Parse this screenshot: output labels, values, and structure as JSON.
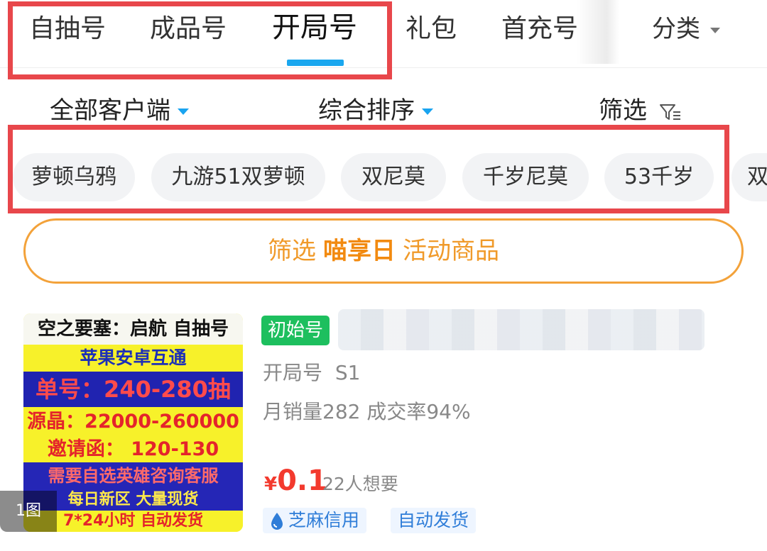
{
  "tabs": {
    "items": [
      {
        "label": "自抽号"
      },
      {
        "label": "成品号"
      },
      {
        "label": "开局号",
        "active": true
      },
      {
        "label": "礼包"
      },
      {
        "label": "首充号"
      }
    ],
    "classify_label": "分类",
    "active_color": "#1aa7ef"
  },
  "sort_bar": {
    "client": "全部客户端",
    "order": "综合排序",
    "filter": "筛选"
  },
  "chips": [
    "萝顿乌鸦",
    "九游51双萝顿",
    "双尼莫",
    "千岁尼莫",
    "53千岁",
    "双"
  ],
  "promo": {
    "prefix": "筛选",
    "highlight": "喵享日",
    "suffix": "活动商品",
    "color": "#f09a2a"
  },
  "product": {
    "thumbnail": {
      "lines": [
        "空之要塞：启航 自抽号",
        "苹果安卓互通",
        "单号：240-280抽",
        "源晶：22000-260000",
        "邀请函： 120-130",
        "需要自选英雄咨询客服",
        "每日新区  大量现货",
        "7*24小时  自动发货"
      ],
      "image_count": "1图"
    },
    "badge": "初始号",
    "category": "开局号",
    "server": "S1",
    "sales": "月销量282 成交率94%",
    "price_currency": "¥",
    "price_value": "0.1",
    "wanted": "22人想要",
    "tags": [
      "芝麻信用",
      "自动发货"
    ],
    "price_color": "#f33a2e"
  },
  "annotation_color": "#e8474b"
}
